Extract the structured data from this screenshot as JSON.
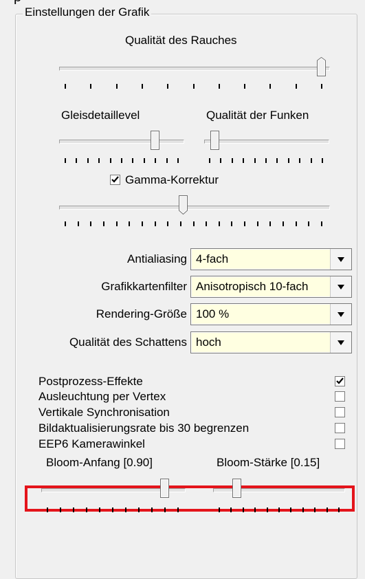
{
  "group": {
    "title": "Einstellungen der Grafik",
    "partial_char": "p"
  },
  "smoke_quality": {
    "label": "Qualität des Rauches",
    "value": 1.0,
    "tick_count": 11
  },
  "track_detail": {
    "label": "Gleisdetaillevel",
    "value": 0.8,
    "tick_count": 11
  },
  "spark_quality": {
    "label": "Qualität der Funken",
    "value": 0.05,
    "tick_count": 11
  },
  "gamma": {
    "checkbox_label": "Gamma-Korrektur",
    "checked": true,
    "slider_value": 0.46,
    "tick_count": 21
  },
  "combos": [
    {
      "label": "Antialiasing",
      "value": "4-fach"
    },
    {
      "label": "Grafikkartenfilter",
      "value": "Anisotropisch 10-fach"
    },
    {
      "label": "Rendering-Größe",
      "value": "100 %"
    },
    {
      "label": "Qualität des Schattens",
      "value": "hoch"
    }
  ],
  "options": [
    {
      "label": "Postprozess-Effekte",
      "checked": true
    },
    {
      "label": "Ausleuchtung per Vertex",
      "checked": false
    },
    {
      "label": "Vertikale Synchronisation",
      "checked": false
    },
    {
      "label": "Bildaktualisierungsrate bis 30 begrenzen",
      "checked": false
    },
    {
      "label": "EEP6 Kamerawinkel",
      "checked": false
    }
  ],
  "bloom_start": {
    "label": "Bloom-Anfang [0.90]",
    "value": 0.9,
    "tick_count": 11
  },
  "bloom_strength": {
    "label": "Bloom-Stärke [0.15]",
    "value": 0.15,
    "tick_count": 11
  },
  "colors": {
    "highlight": "#e4141b",
    "combo_value_bg": "#ffffe1",
    "dialog_bg": "#f0f0f0"
  }
}
